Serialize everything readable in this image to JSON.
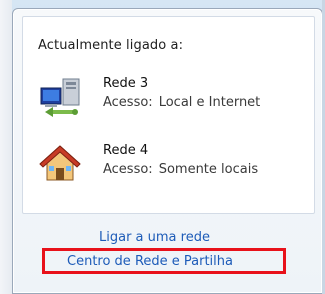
{
  "panel": {
    "title": "Actualmente ligado a:",
    "access_label": "Acesso:",
    "networks": [
      {
        "name": "Rede 3",
        "access": "Local e Internet",
        "icon": "network-computer-icon"
      },
      {
        "name": "Rede 4",
        "access": "Somente locais",
        "icon": "home-network-icon"
      }
    ]
  },
  "links": {
    "connect": "Ligar a uma rede",
    "center": "Centro de Rede e Partilha"
  },
  "colors": {
    "link": "#1d5bb8",
    "highlight": "#e8111a"
  }
}
